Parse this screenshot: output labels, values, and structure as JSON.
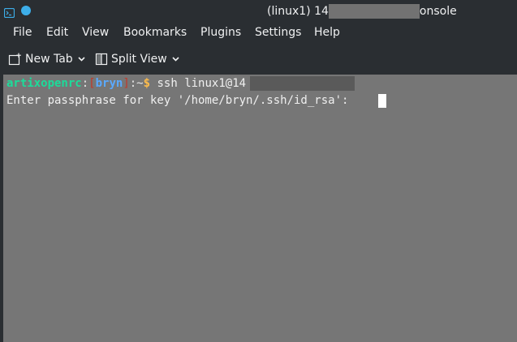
{
  "window": {
    "title_left": "(linux1) 14",
    "title_right": "onsole",
    "accent_color": "#3daee9"
  },
  "menubar": {
    "items": [
      "File",
      "Edit",
      "View",
      "Bookmarks",
      "Plugins",
      "Settings",
      "Help"
    ]
  },
  "toolbar": {
    "new_tab_label": "New Tab",
    "split_view_label": "Split View",
    "new_tab_icon": "new-tab-icon",
    "split_view_icon": "split-view-icon"
  },
  "terminal": {
    "background": "#767676",
    "prompt": {
      "host": "artixopenrc",
      "sep": ":",
      "open_bracket": "[",
      "user": "bryn",
      "close_bracket": "]",
      "path": ":~",
      "symbol": "$"
    },
    "command": " ssh linux1@14",
    "passphrase_prompt": "Enter passphrase for key '/home/bryn/.ssh/id_rsa': "
  }
}
